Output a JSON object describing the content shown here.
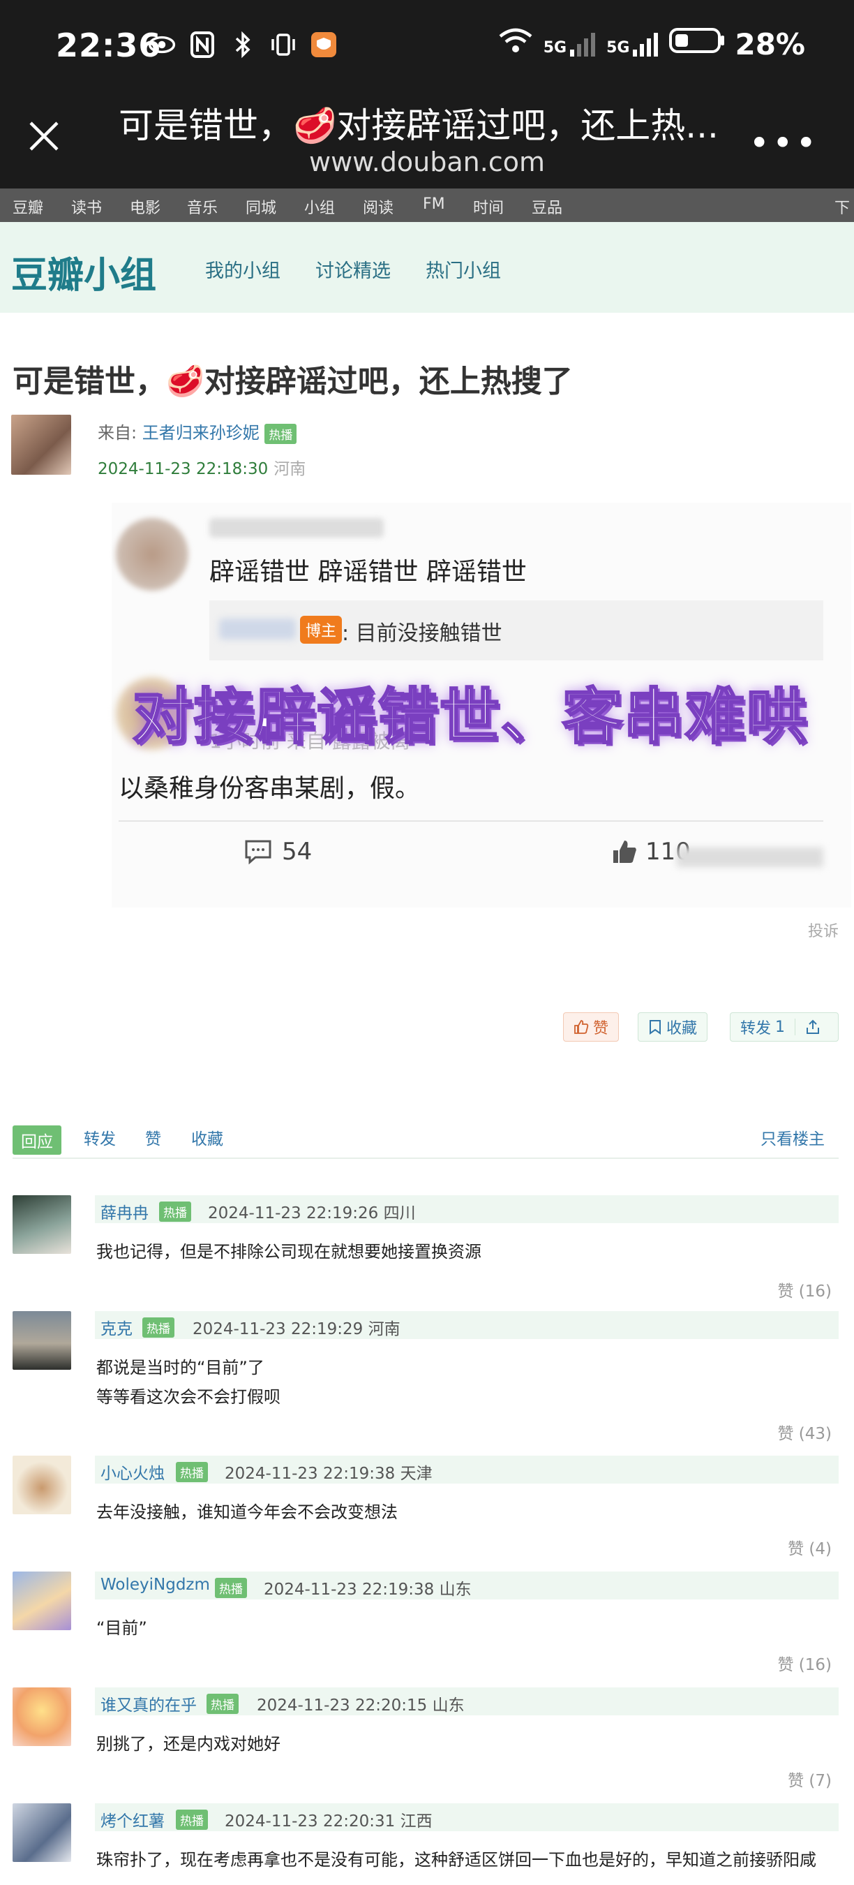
{
  "statusbar": {
    "time": "22:36",
    "signal1": "5G",
    "signal2": "5G",
    "battery": "28%"
  },
  "titlebar": {
    "title": "可是错世，🥩对接辟谣过吧，还上热...",
    "url": "www.douban.com",
    "more": "•••"
  },
  "topnav": [
    "豆瓣",
    "读书",
    "电影",
    "音乐",
    "同城",
    "小组",
    "阅读",
    "FM",
    "时间",
    "豆品",
    "下载"
  ],
  "group": {
    "logo": "豆瓣小组",
    "tabs": [
      "我的小组",
      "讨论精选",
      "热门小组"
    ]
  },
  "post": {
    "title": "可是错世，🥩对接辟谣过吧，还上热搜了",
    "from_label": "来自:",
    "author": "王者归来孙珍妮",
    "badge": "热播",
    "date": "2024-11-23 22:18:30",
    "location": "河南"
  },
  "embed": {
    "repeat_text": "辟谣错世 辟谣错世 辟谣错世",
    "host_badge": "博主",
    "quote_text": ": 目前没接触错世",
    "overlay_text": "对接辟谣错世、客串难哄",
    "meta_text": "1小时前  来自 露露被离",
    "body_text": "以桑稚身份客串某剧，假。",
    "comment_count": "54",
    "like_count": "110"
  },
  "report": "投诉",
  "buttons": {
    "like": "赞",
    "collect": "收藏",
    "share": "转发",
    "share_count": "1"
  },
  "actions": {
    "reply": "回应",
    "forward": "转发",
    "like": "赞",
    "collect": "收藏",
    "only_op": "只看楼主"
  },
  "comments": [
    {
      "name": "薛冉冉",
      "badge": "热播",
      "date": "2024-11-23 22:19:26",
      "loc": "四川",
      "lines": [
        "我也记得，但是不排除公司现在就想要她接置换资源"
      ],
      "likes": "赞 (16)"
    },
    {
      "name": "克克",
      "badge": "热播",
      "date": "2024-11-23 22:19:29",
      "loc": "河南",
      "lines": [
        "都说是当时的“目前”了",
        "等等看这次会不会打假呗"
      ],
      "likes": "赞 (43)"
    },
    {
      "name": "小心火烛",
      "badge": "热播",
      "date": "2024-11-23 22:19:38",
      "loc": "天津",
      "lines": [
        "去年没接触，谁知道今年会不会改变想法"
      ],
      "likes": "赞 (4)"
    },
    {
      "name": "WoleyiNgdzm",
      "badge": "热播",
      "date": "2024-11-23 22:19:38",
      "loc": "山东",
      "lines": [
        "“目前”"
      ],
      "likes": "赞 (16)"
    },
    {
      "name": "谁又真的在乎",
      "badge": "热播",
      "date": "2024-11-23 22:20:15",
      "loc": "山东",
      "lines": [
        "别挑了，还是内戏对她好"
      ],
      "likes": "赞 (7)"
    },
    {
      "name": "烤个红薯",
      "badge": "热播",
      "date": "2024-11-23 22:20:31",
      "loc": "江西",
      "lines": [
        "珠帘扑了，现在考虑再拿也不是没有可能，这种舒适区饼回一下血也是好的，早知道之前接骄阳咸"
      ],
      "likes": ""
    }
  ]
}
